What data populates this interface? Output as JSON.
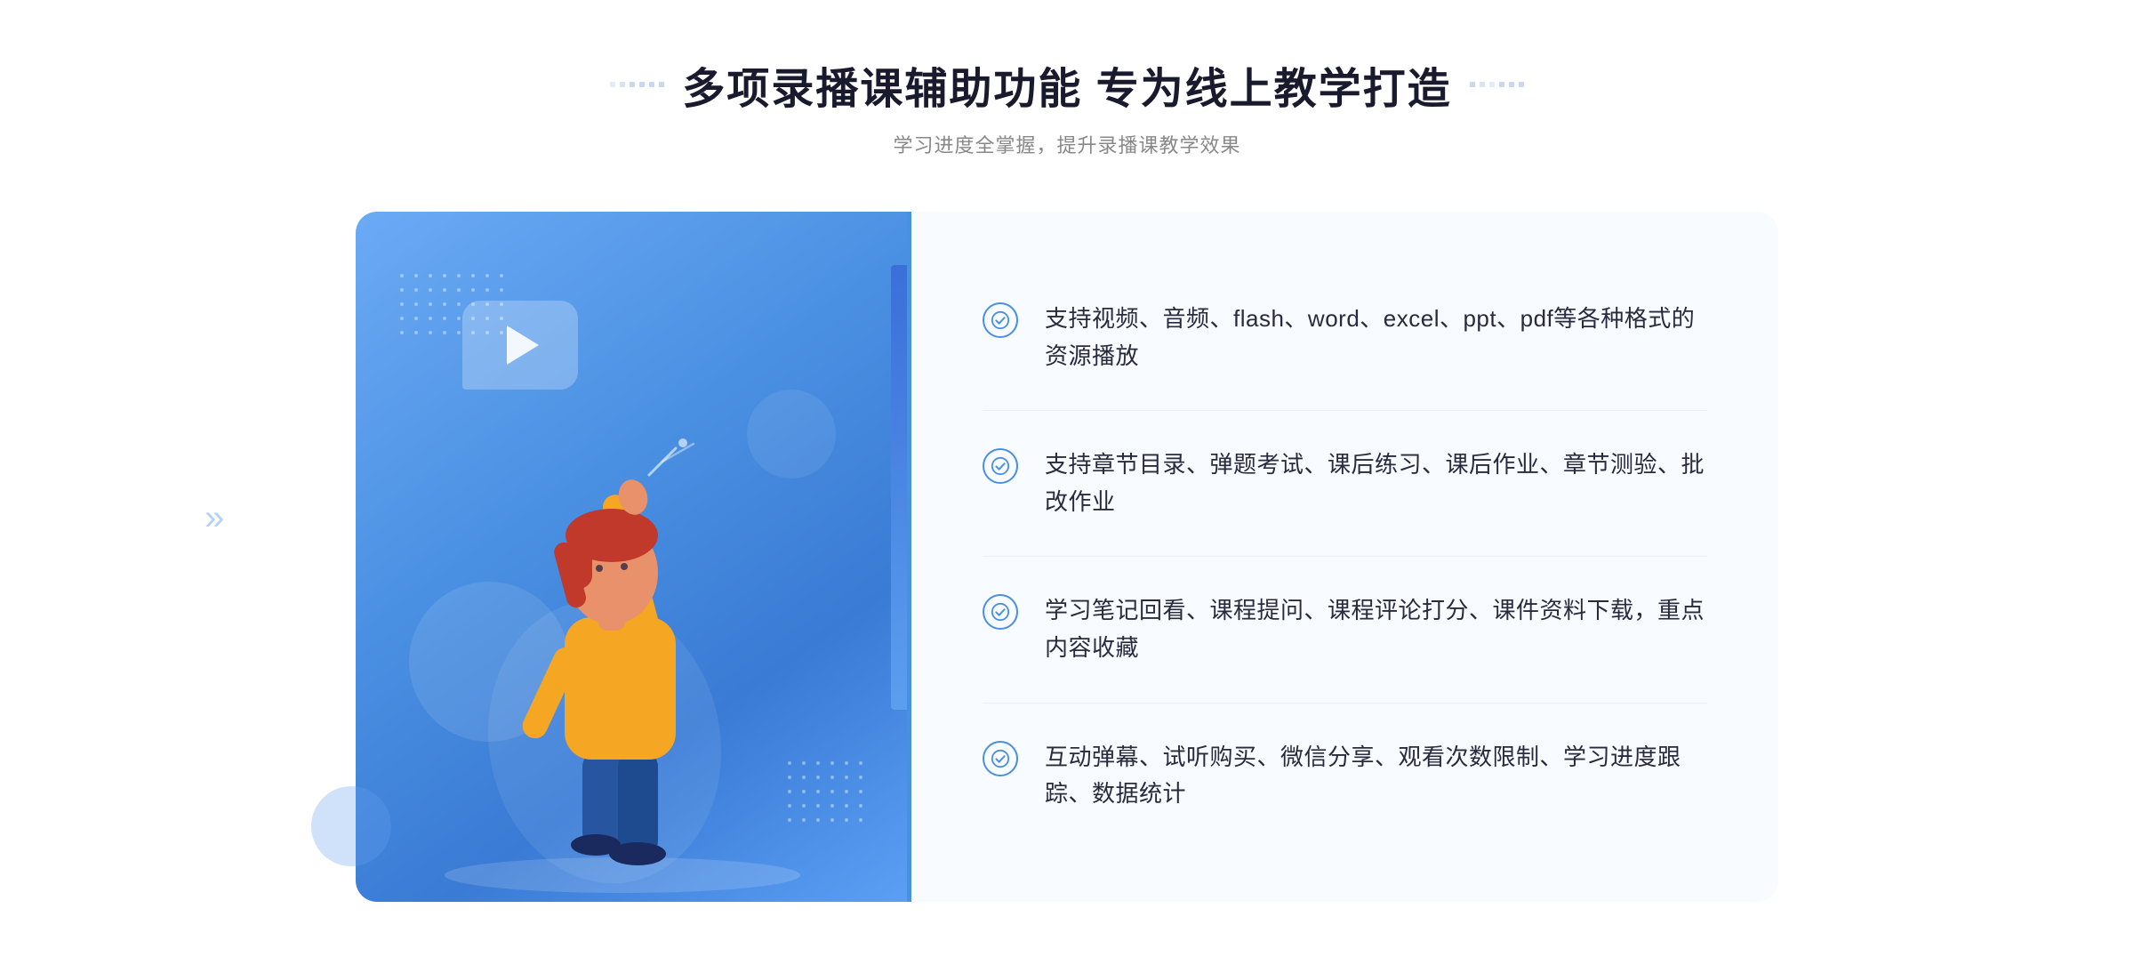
{
  "header": {
    "main_title": "多项录播课辅助功能 专为线上教学打造",
    "sub_title": "学习进度全掌握，提升录播课教学效果"
  },
  "features": [
    {
      "id": "feature-1",
      "text": "支持视频、音频、flash、word、excel、ppt、pdf等各种格式的资源播放"
    },
    {
      "id": "feature-2",
      "text": "支持章节目录、弹题考试、课后练习、课后作业、章节测验、批改作业"
    },
    {
      "id": "feature-3",
      "text": "学习笔记回看、课程提问、课程评论打分、课件资料下载，重点内容收藏"
    },
    {
      "id": "feature-4",
      "text": "互动弹幕、试听购买、微信分享、观看次数限制、学习进度跟踪、数据统计"
    }
  ],
  "colors": {
    "accent_blue": "#4a90e2",
    "light_blue": "#6baaf5",
    "title_dark": "#1a1a2e",
    "text_gray": "#888888",
    "feature_text": "#2a2a3e",
    "bg_light": "#f8fbff"
  },
  "decoration": {
    "left_arrow": "»",
    "play_icon": "▶"
  }
}
